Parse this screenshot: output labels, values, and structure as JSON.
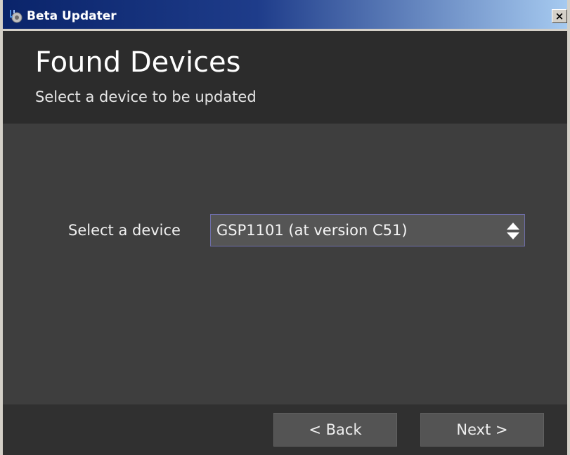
{
  "window": {
    "title": "Beta Updater",
    "close_glyph": "×"
  },
  "header": {
    "title": "Found Devices",
    "subtitle": "Select a device to be updated"
  },
  "content": {
    "device_label": "Select a device",
    "selected_device": "GSP1101 (at version C51)"
  },
  "footer": {
    "back_label": "< Back",
    "next_label": "Next >"
  },
  "icons": {
    "app": "beta-updater-app-icon",
    "close": "close-icon",
    "select_arrows": "up-down-arrows-icon"
  },
  "colors": {
    "titlebar_start": "#0a246a",
    "titlebar_end": "#a6caf0",
    "header_bg": "#2c2c2c",
    "content_bg": "#3e3e3e",
    "footer_bg": "#303030",
    "select_border": "#6e6ea8"
  }
}
